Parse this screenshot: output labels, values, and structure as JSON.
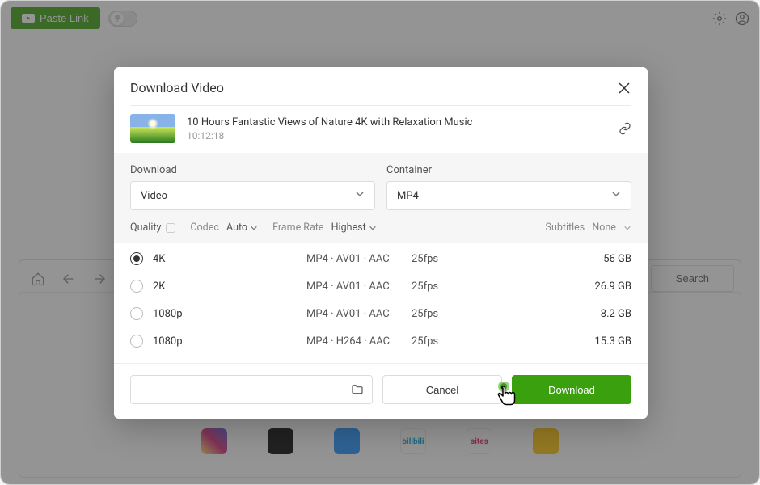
{
  "header": {
    "paste_link": "Paste Link"
  },
  "nav": {
    "search": "Search"
  },
  "modal": {
    "title": "Download Video",
    "video": {
      "title": "10 Hours Fantastic Views of Nature 4K with Relaxation Music",
      "duration": "10:12:18"
    },
    "params": {
      "download_label": "Download",
      "download_value": "Video",
      "container_label": "Container",
      "container_value": "MP4"
    },
    "filters": {
      "quality_label": "Quality",
      "codec_label": "Codec",
      "codec_value": "Auto",
      "framerate_label": "Frame Rate",
      "framerate_value": "Highest",
      "subtitles_label": "Subtitles",
      "subtitles_value": "None"
    },
    "quality_rows": [
      {
        "name": "4K",
        "codec": "MP4 · AV01 · AAC",
        "fps": "25fps",
        "size": "56 GB",
        "selected": true
      },
      {
        "name": "2K",
        "codec": "MP4 · AV01 · AAC",
        "fps": "25fps",
        "size": "26.9 GB",
        "selected": false
      },
      {
        "name": "1080p",
        "codec": "MP4 · AV01 · AAC",
        "fps": "25fps",
        "size": "8.2 GB",
        "selected": false
      },
      {
        "name": "1080p",
        "codec": "MP4 · H264 · AAC",
        "fps": "25fps",
        "size": "15.3 GB",
        "selected": false
      }
    ],
    "footer": {
      "cancel": "Cancel",
      "download": "Download"
    }
  },
  "site_labels": [
    "",
    "",
    "",
    "bilibili",
    "sites",
    ""
  ]
}
